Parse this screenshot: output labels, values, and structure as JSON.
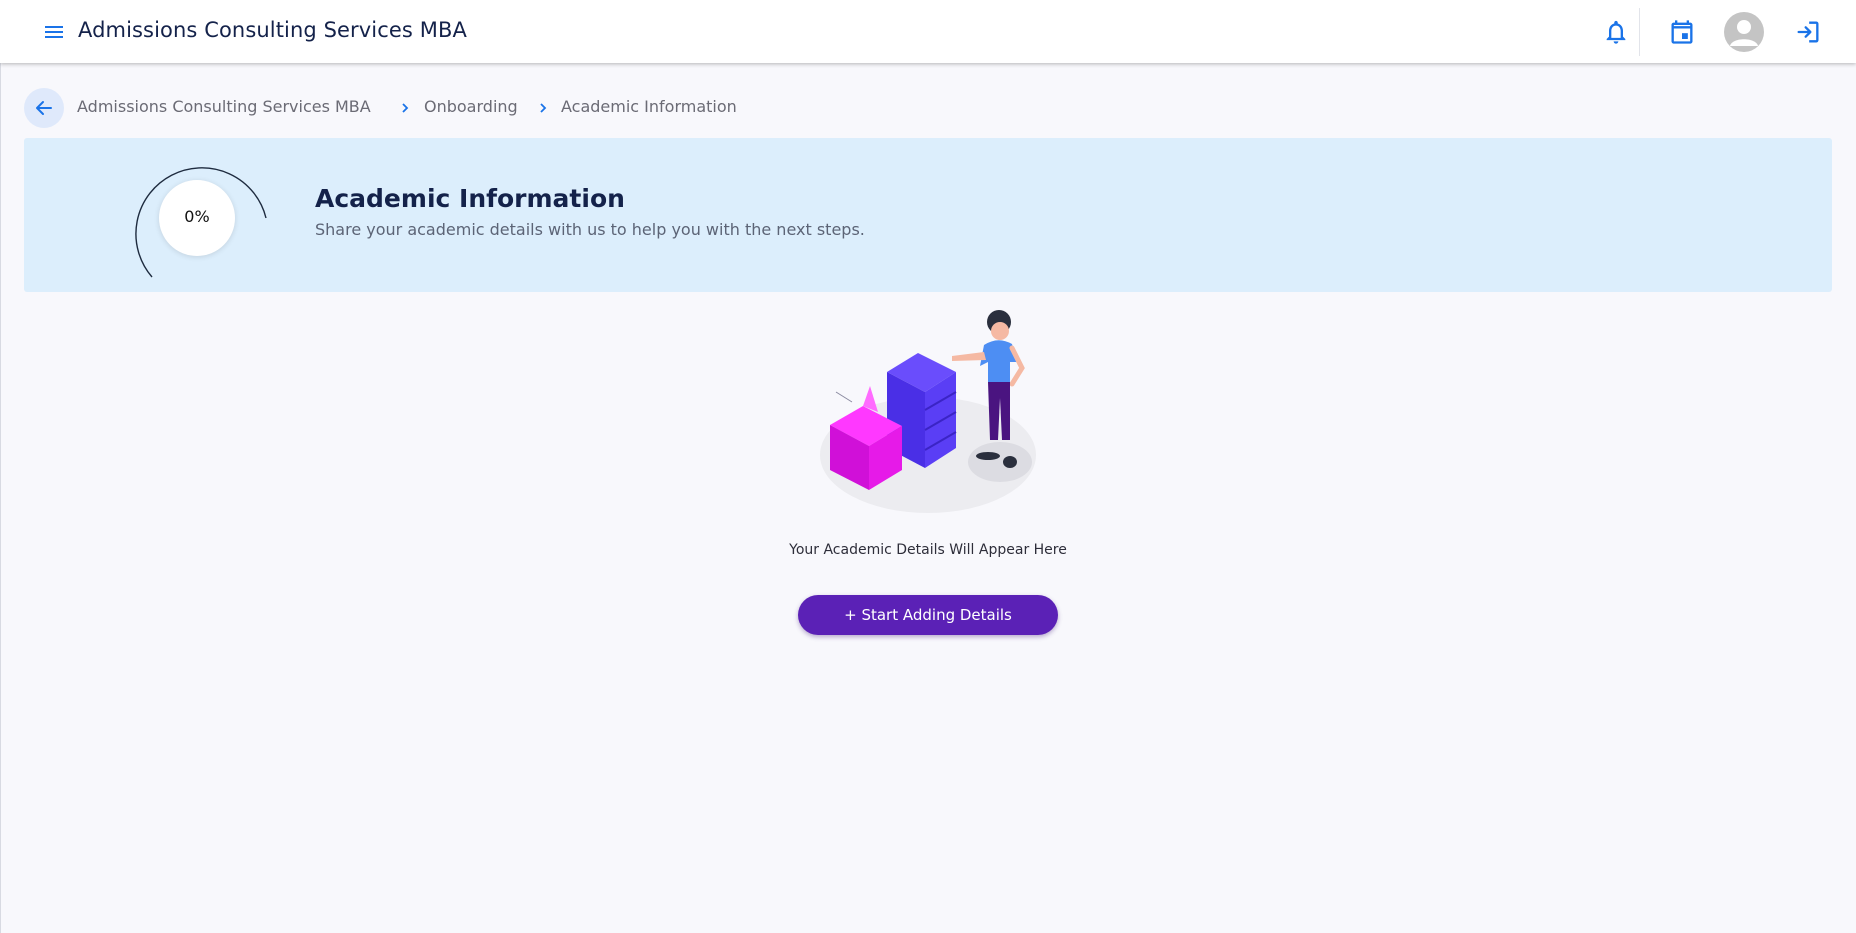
{
  "header": {
    "title": "Admissions Consulting Services MBA",
    "icons": [
      "menu-icon",
      "bell-icon",
      "calendar-icon",
      "avatar",
      "logout-icon"
    ]
  },
  "breadcrumb": {
    "items": [
      "Admissions Consulting Services MBA",
      "Onboarding",
      "Academic Information"
    ]
  },
  "banner": {
    "progress": "0%",
    "progress_value": 0,
    "title": "Academic Information",
    "subtitle": "Share your academic details with us to help you with the next steps."
  },
  "empty_state": {
    "message": "Your Academic Details Will Appear Here",
    "button_label": "+ Start Adding Details"
  },
  "colors": {
    "accent": "#1a73e8",
    "banner_bg": "#dceefc",
    "button_bg": "#5b21b6",
    "title": "#14224a"
  }
}
